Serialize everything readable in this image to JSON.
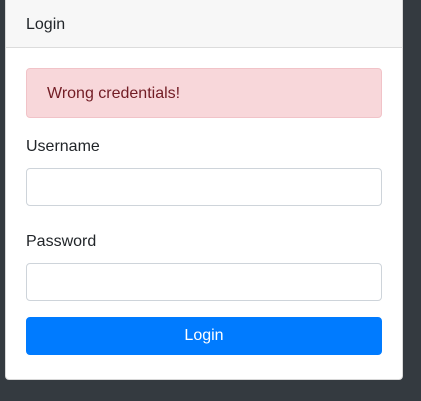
{
  "card": {
    "title": "Login"
  },
  "alert": {
    "message": "Wrong credentials!"
  },
  "form": {
    "username_label": "Username",
    "username_value": "",
    "username_placeholder": "",
    "password_label": "Password",
    "password_value": "",
    "password_placeholder": "",
    "submit_label": "Login"
  },
  "colors": {
    "page_background": "#343a40",
    "alert_background": "#f8d7da",
    "alert_text": "#721c24",
    "primary_button": "#007bff"
  }
}
